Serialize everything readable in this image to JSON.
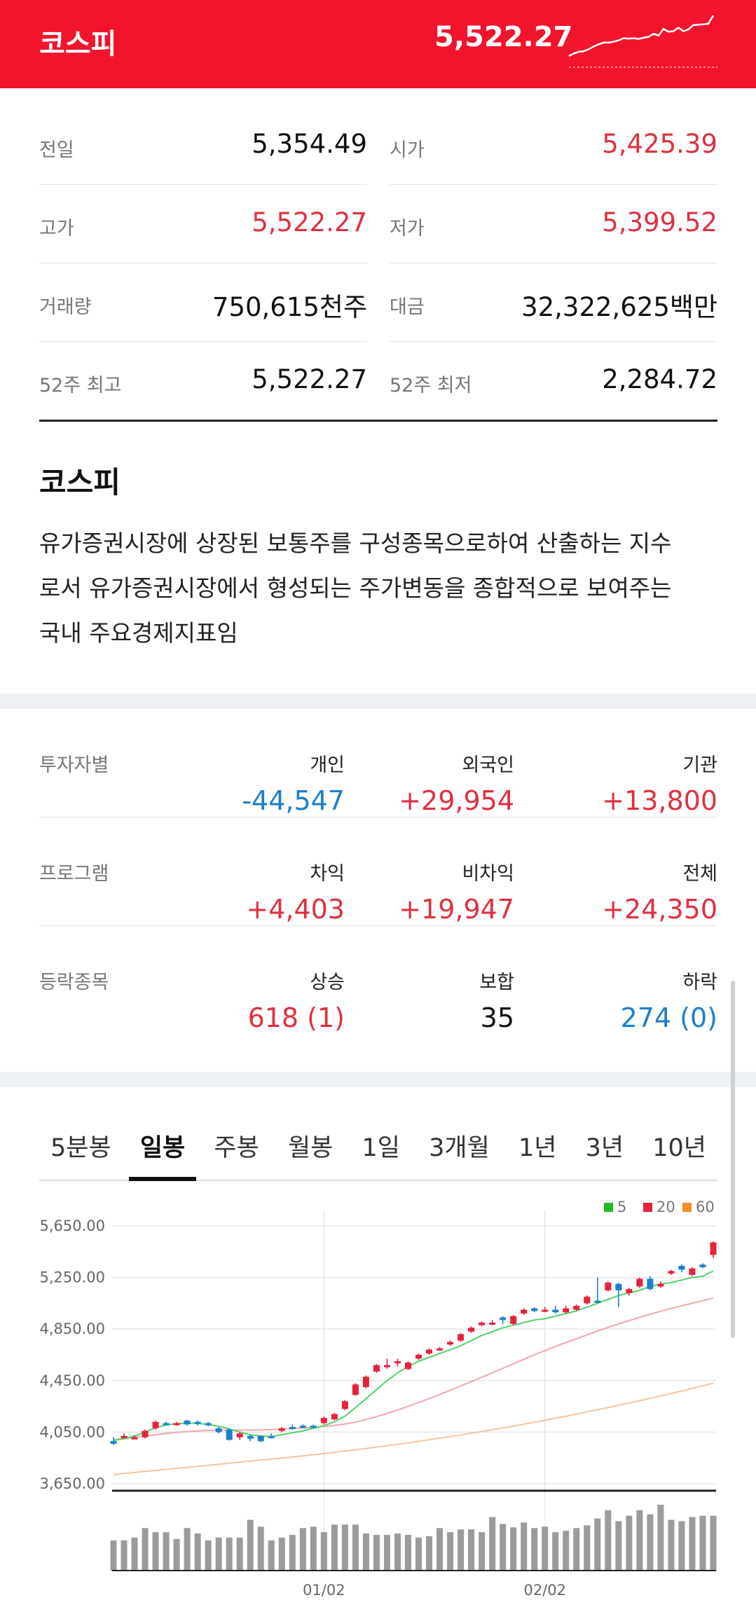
{
  "header": {
    "title": "코스피",
    "price": "5,522.27",
    "colors": {
      "background": "#f2142d",
      "text": "#ffffff"
    }
  },
  "stats": [
    {
      "label": "전일",
      "value": "5,354.49",
      "up": false
    },
    {
      "label": "시가",
      "value": "5,425.39",
      "up": true
    },
    {
      "label": "고가",
      "value": "5,522.27",
      "up": true
    },
    {
      "label": "저가",
      "value": "5,399.52",
      "up": true
    },
    {
      "label": "거래량",
      "value": "750,615천주",
      "up": false
    },
    {
      "label": "대금",
      "value": "32,322,625백만",
      "up": false
    },
    {
      "label": "52주 최고",
      "value": "5,522.27",
      "up": false
    },
    {
      "label": "52주 최저",
      "value": "2,284.72",
      "up": false
    }
  ],
  "description": {
    "title": "코스피",
    "lines": [
      "유가증권시장에 상장된 보통주를 구성종목으로하여 산출하는 지수",
      "로서 유가증권시장에서 형성되는 주가변동을 종합적으로 보여주는",
      "국내 주요경제지표임"
    ]
  },
  "investors": {
    "label": "투자자별",
    "cols": [
      {
        "head": "개인",
        "value": "-44,547",
        "dir": "dn"
      },
      {
        "head": "외국인",
        "value": "+29,954",
        "dir": "up"
      },
      {
        "head": "기관",
        "value": "+13,800",
        "dir": "up"
      }
    ]
  },
  "program": {
    "label": "프로그램",
    "cols": [
      {
        "head": "차익",
        "value": "+4,403",
        "dir": "up"
      },
      {
        "head": "비차익",
        "value": "+19,947",
        "dir": "up"
      },
      {
        "head": "전체",
        "value": "+24,350",
        "dir": "up"
      }
    ]
  },
  "breadth": {
    "label": "등락종목",
    "cols": [
      {
        "head": "상승",
        "value": "618 (1)",
        "dir": "up"
      },
      {
        "head": "보합",
        "value": "35",
        "dir": "eq"
      },
      {
        "head": "하락",
        "value": "274 (0)",
        "dir": "dn"
      }
    ]
  },
  "tabs": {
    "items": [
      "5분봉",
      "일봉",
      "주봉",
      "월봉",
      "1일",
      "3개월",
      "1년",
      "3년",
      "10년"
    ],
    "active": 1
  },
  "chart_data": {
    "type": "candlestick",
    "legend": [
      {
        "label": "5",
        "color": "#22b922"
      },
      {
        "label": "20",
        "color": "#e8213b"
      },
      {
        "label": "60",
        "color": "#f08c2c"
      }
    ],
    "y_ticks": [
      "5,650.00",
      "5,250.00",
      "4,850.00",
      "4,450.00",
      "4,050.00",
      "3,650.00"
    ],
    "ylim": [
      3650,
      5650
    ],
    "x_labels": [
      "01/02",
      "02/02"
    ],
    "x_label_index": [
      20,
      41
    ],
    "candles": [
      [
        3980,
        3960,
        4010,
        3950
      ],
      [
        4010,
        4020,
        4040,
        4000
      ],
      [
        4000,
        4010,
        4025,
        3995
      ],
      [
        4010,
        4060,
        4070,
        4000
      ],
      [
        4080,
        4130,
        4140,
        4070
      ],
      [
        4120,
        4115,
        4130,
        4100
      ],
      [
        4110,
        4120,
        4130,
        4100
      ],
      [
        4140,
        4110,
        4145,
        4100
      ],
      [
        4130,
        4115,
        4140,
        4100
      ],
      [
        4120,
        4110,
        4130,
        4095
      ],
      [
        4080,
        4050,
        4090,
        4040
      ],
      [
        4070,
        3990,
        4080,
        3985
      ],
      [
        4010,
        4040,
        4050,
        3990
      ],
      [
        4020,
        4000,
        4030,
        3980
      ],
      [
        4020,
        3980,
        4025,
        3970
      ],
      [
        4020,
        4010,
        4040,
        4000
      ],
      [
        4060,
        4080,
        4090,
        4050
      ],
      [
        4090,
        4080,
        4110,
        4070
      ],
      [
        4100,
        4090,
        4110,
        4080
      ],
      [
        4100,
        4090,
        4110,
        4080
      ],
      [
        4120,
        4160,
        4170,
        4110
      ],
      [
        4150,
        4190,
        4200,
        4140
      ],
      [
        4230,
        4290,
        4300,
        4220
      ],
      [
        4340,
        4420,
        4430,
        4330
      ],
      [
        4400,
        4480,
        4490,
        4390
      ],
      [
        4520,
        4570,
        4580,
        4510
      ],
      [
        4560,
        4570,
        4620,
        4540
      ],
      [
        4590,
        4600,
        4620,
        4560
      ],
      [
        4540,
        4590,
        4600,
        4530
      ],
      [
        4620,
        4650,
        4660,
        4610
      ],
      [
        4660,
        4690,
        4700,
        4650
      ],
      [
        4690,
        4700,
        4710,
        4680
      ],
      [
        4730,
        4750,
        4760,
        4720
      ],
      [
        4760,
        4810,
        4820,
        4750
      ],
      [
        4830,
        4860,
        4870,
        4820
      ],
      [
        4880,
        4900,
        4910,
        4870
      ],
      [
        4890,
        4900,
        4920,
        4880
      ],
      [
        4940,
        4920,
        4950,
        4890
      ],
      [
        4890,
        4950,
        4960,
        4880
      ],
      [
        4970,
        5000,
        5010,
        4960
      ],
      [
        5010,
        4990,
        5020,
        4980
      ],
      [
        4990,
        5000,
        5020,
        4980
      ],
      [
        5000,
        4980,
        5030,
        4970
      ],
      [
        4980,
        5010,
        5030,
        4970
      ],
      [
        5000,
        5030,
        5040,
        4990
      ],
      [
        5050,
        5100,
        5110,
        5040
      ],
      [
        5070,
        5060,
        5250,
        5050
      ],
      [
        5150,
        5210,
        5220,
        5140
      ],
      [
        5200,
        5150,
        5210,
        5020
      ],
      [
        5130,
        5160,
        5170,
        5110
      ],
      [
        5180,
        5240,
        5250,
        5170
      ],
      [
        5240,
        5160,
        5260,
        5150
      ],
      [
        5180,
        5200,
        5220,
        5170
      ],
      [
        5280,
        5300,
        5310,
        5270
      ],
      [
        5340,
        5310,
        5350,
        5290
      ],
      [
        5270,
        5320,
        5330,
        5260
      ],
      [
        5350,
        5330,
        5360,
        5320
      ],
      [
        5425,
        5522,
        5530,
        5400
      ]
    ],
    "ma5": [
      3985,
      4000,
      4020,
      4050,
      4085,
      4105,
      4115,
      4120,
      4118,
      4110,
      4095,
      4075,
      4050,
      4030,
      4020,
      4015,
      4030,
      4045,
      4060,
      4080,
      4100,
      4130,
      4175,
      4240,
      4310,
      4380,
      4450,
      4510,
      4560,
      4600,
      4630,
      4660,
      4690,
      4720,
      4760,
      4800,
      4830,
      4860,
      4880,
      4900,
      4920,
      4930,
      4950,
      4970,
      4990,
      5020,
      5050,
      5080,
      5110,
      5130,
      5150,
      5180,
      5200,
      5210,
      5230,
      5250,
      5260,
      5300
    ],
    "ma20": [
      3990,
      4000,
      4010,
      4020,
      4030,
      4040,
      4048,
      4055,
      4060,
      4063,
      4065,
      4066,
      4066,
      4066,
      4067,
      4070,
      4074,
      4078,
      4082,
      4087,
      4094,
      4102,
      4113,
      4128,
      4148,
      4170,
      4195,
      4222,
      4250,
      4280,
      4310,
      4342,
      4375,
      4408,
      4442,
      4476,
      4510,
      4545,
      4580,
      4615,
      4650,
      4683,
      4715,
      4745,
      4775,
      4805,
      4835,
      4862,
      4890,
      4915,
      4940,
      4965,
      4988,
      5010,
      5030,
      5050,
      5070,
      5090
    ],
    "ma60": [
      3720,
      3729,
      3737,
      3745,
      3753,
      3761,
      3769,
      3777,
      3785,
      3793,
      3801,
      3809,
      3817,
      3825,
      3833,
      3841,
      3849,
      3857,
      3866,
      3875,
      3884,
      3893,
      3903,
      3913,
      3923,
      3934,
      3945,
      3956,
      3967,
      3979,
      3991,
      4003,
      4016,
      4029,
      4042,
      4055,
      4069,
      4083,
      4097,
      4112,
      4127,
      4142,
      4158,
      4174,
      4190,
      4207,
      4224,
      4241,
      4258,
      4276,
      4294,
      4312,
      4331,
      4350,
      4369,
      4389,
      4409,
      4430
    ],
    "volume": [
      44,
      44,
      48,
      62,
      56,
      56,
      46,
      62,
      54,
      44,
      48,
      48,
      48,
      74,
      64,
      44,
      48,
      52,
      62,
      64,
      56,
      67,
      67,
      67,
      54,
      52,
      52,
      54,
      52,
      48,
      50,
      62,
      56,
      60,
      60,
      56,
      78,
      68,
      63,
      70,
      62,
      64,
      56,
      58,
      62,
      66,
      76,
      88,
      72,
      80,
      88,
      82,
      96,
      74,
      72,
      78,
      80,
      80
    ]
  }
}
